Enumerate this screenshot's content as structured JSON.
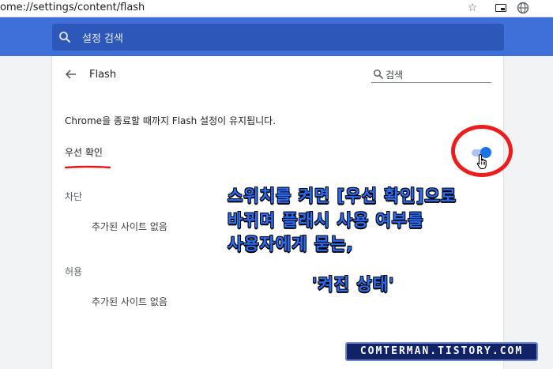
{
  "browser": {
    "url": "ome://settings/content/flash",
    "icons": [
      "bookmark-star-icon",
      "media-router-icon",
      "globe-icon",
      "profile-avatar-icon"
    ]
  },
  "header": {
    "search_placeholder": "설정 검색"
  },
  "page": {
    "title": "Flash",
    "search_placeholder": "검색",
    "description": "Chrome을 종료할 때까지 Flash 설정이 유지됩니다.",
    "ask_first_label": "우선 확인",
    "toggle_on": true,
    "blocked_header": "차단",
    "blocked_empty": "추가된 사이트 없음",
    "allowed_header": "허용",
    "allowed_empty": "추가된 사이트 없음"
  },
  "annotation": {
    "line1": "스위치를 켜면 [우선 확인]으로",
    "line2": "바뀌며 플래시 사용 여부를",
    "line3": "사용자에게 묻는,",
    "line4": "'켜진 상태'",
    "circle_color": "#ee1c1c",
    "text_color": "#2b6df7"
  },
  "watermark": "COMTERMAN.TISTORY.COM",
  "colors": {
    "header_blue": "#3f6fd8",
    "toggle_blue": "#1a73e8",
    "underline_red": "#e8171b"
  }
}
